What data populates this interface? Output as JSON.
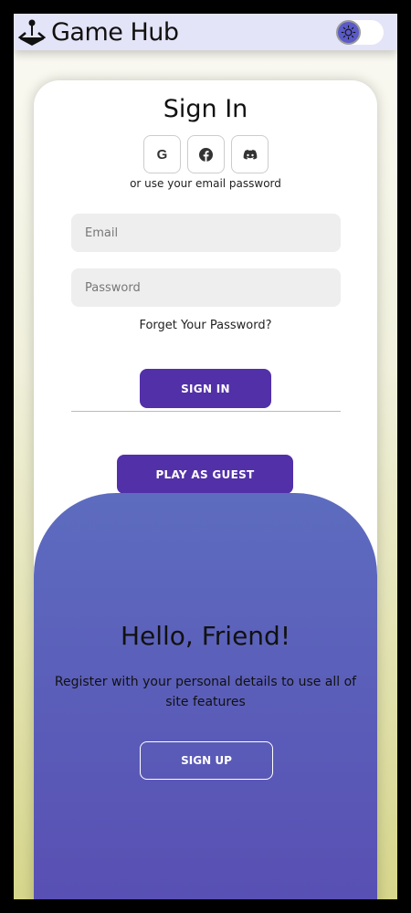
{
  "header": {
    "title": "Game Hub",
    "logo_icon": "joystick-icon",
    "theme_toggle_icon": "sun-icon",
    "theme_mode": "light"
  },
  "signin": {
    "title": "Sign In",
    "socials": [
      {
        "icon": "google-icon",
        "label": "G"
      },
      {
        "icon": "facebook-icon"
      },
      {
        "icon": "discord-icon"
      }
    ],
    "or_text": "or use your email password",
    "email_placeholder": "Email",
    "password_placeholder": "Password",
    "forgot": "Forget Your Password?",
    "signin_button": "SIGN IN",
    "guest_button": "PLAY AS GUEST"
  },
  "panel": {
    "title": "Hello, Friend!",
    "text": "Register with your personal details to use all of site features",
    "signup_button": "SIGN UP"
  },
  "colors": {
    "primary": "#5230a8",
    "panel_top": "#5d6cbf",
    "panel_bottom": "#584db2",
    "header_bg": "#e4e4f8"
  }
}
